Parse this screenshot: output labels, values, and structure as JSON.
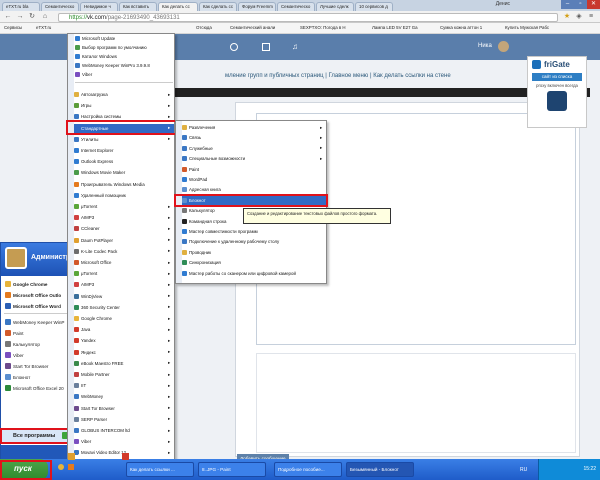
{
  "browser": {
    "tabs": [
      "eTXT.ru bla",
      "Семантическо",
      "Невидимое ч",
      "Как вставить",
      "Как делать сс",
      "Как сделать сс",
      "Форум Freemm",
      "Семантическо",
      "Лучшие сделк",
      "10 сервисов д"
    ],
    "profile": "Денис",
    "url_prefix": "https://",
    "url_host": "vk.com",
    "url_path": "/page-21693490_43693131",
    "bookmarks": [
      "Сервисы",
      "eTXT.ru",
      "Отсюда",
      "Семантический анали",
      "SEXPTXO: Погода в Н",
      "Лампа LED 5V E27 Ga",
      "Сумка кожна аттон 1",
      "Купить Мужская Рабс"
    ]
  },
  "vk": {
    "breadcrumb": "мление групп и публичных страниц  |  Главное меню  |  Как делать ссылки на стене",
    "user": "Ника",
    "add_post_button": "Добавить сообщение"
  },
  "frigate": {
    "title": "friGate",
    "status_button": "сайт из списка",
    "sub_text": "proxy включен всегда"
  },
  "start_menu": {
    "username": "Администр",
    "pinned": [
      "Google Chrome",
      "Microsoft Office Outlo",
      "Microsoft Office Word"
    ],
    "recent": [
      "WebMoney Keeper WinP",
      "Paint",
      "Калькулятор",
      "Viber",
      "Start Tor Browser",
      "Блокнот",
      "Microsoft Office Excel 20"
    ],
    "all_programs": "Все программы",
    "logoff": "Выход из системы",
    "shutdown": "Выключение"
  },
  "programs_menu": {
    "top_items": [
      "Microsoft Update",
      "Выбор программ по умолчанию",
      "Каталог Windows",
      "WebMoney Keeper WinPro 3.9.9.8",
      "Viber"
    ],
    "items": [
      "Автозагрузка",
      "Игры",
      "Настройка системы",
      "Стандартные",
      "Утилиты",
      "Internet Explorer",
      "Outlook Express",
      "Windows Movie Maker",
      "Проигрыватель Windows Media",
      "Удаленный помощник",
      "μTorrent",
      "AIMP3",
      "CCleaner",
      "Daum PotPlayer",
      "K-Lite Codec Pack",
      "Microsoft Office",
      "μTorrent",
      "AIMP3",
      "WinDjView",
      "360 Security Center",
      "Google Chrome",
      "Java",
      "Yandex",
      "Яндекс",
      "eBook Maestro FREE",
      "Mobile Partner",
      "IIT",
      "WebMoney",
      "Start Tor Browser",
      "SERP Parser",
      "GLOBUS INTERCOM ltd",
      "Viber",
      "Movavi Video Editor 12"
    ],
    "selected": "Стандартные"
  },
  "accessories_menu": {
    "items": [
      "Развлечения",
      "Связь",
      "Служебные",
      "Специальные возможности",
      "Paint",
      "WordPad",
      "Адресная книга",
      "Блокнот",
      "Калькулятор",
      "Командная строка",
      "Мастер совместимости программ",
      "Подключение к удаленному рабочему столу",
      "Проводник",
      "Синхронизация",
      "Мастер работы со сканером или цифровой камерой"
    ],
    "selected": "Блокнот"
  },
  "tooltip": "Создание и редактирование текстовых файлов простого формата.",
  "taskbar": {
    "start": "пуск",
    "tasks": [
      "Как делать ссылки ...",
      "8..JPG - Paint",
      "Подробное пособие...",
      "Безымянный - Блокнот"
    ],
    "lang": "RU",
    "clock": "15:22"
  },
  "colors": {
    "highlight": "#e0121b",
    "selection": "#316ac5",
    "vk_header": "#5a7eab"
  }
}
